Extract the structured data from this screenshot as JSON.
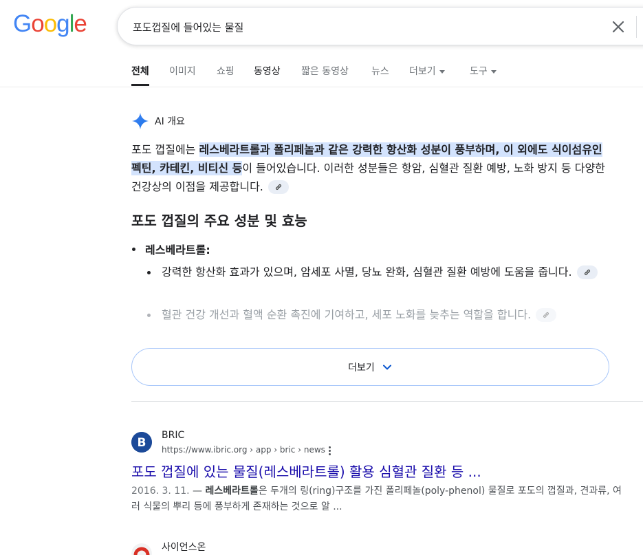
{
  "search": {
    "query": "포도껍질에 들어있는 물질"
  },
  "tabs": [
    {
      "label": "전체",
      "active": true
    },
    {
      "label": "이미지"
    },
    {
      "label": "쇼핑"
    },
    {
      "label": "동영상"
    },
    {
      "label": "짧은 동영상"
    },
    {
      "label": "뉴스"
    },
    {
      "label": "더보기"
    },
    {
      "label": "도구"
    }
  ],
  "ai_overview": {
    "label": "AI 개요",
    "intro_before": "포도 껍질에는 ",
    "intro_highlight": "레스베라트롤과 폴리페놀과 같은 강력한 항산화 성분이 풍부하며, 이 외에도 식이섬유인 펙틴, 카테킨, 비티신 등",
    "intro_after": "이 들어있습니다. 이러한 성분들은 항암, 심혈관 질환 예방, 노화 방지 등 다양한 건강상의 이점을 제공합니다.",
    "section_title": "포도 껍질의 주요 성분 및 효능",
    "item_title": "레스베라트롤:",
    "sub_items": [
      "강력한 항산화 효과가 있으며, 암세포 사멸, 당뇨 완화, 심혈관 질환 예방에 도움을 줍니다.",
      "혈관 건강 개선과 혈액 순환 촉진에 기여하고, 세포 노화를 늦추는 역할을 합니다."
    ],
    "more_label": "더보기"
  },
  "results": [
    {
      "site": "BRIC",
      "url": "https://www.ibric.org › app › bric › news",
      "title": "포도 껍질에 있는 물질(레스베라트롤) 활용 심혈관 질환 등 ...",
      "date": "2016. 3. 11.",
      "snippet_bold": "레스베라트롤",
      "snippet_rest": "은 두개의 링(ring)구조를 가진 폴리페놀(poly-phenol) 물질로 포도의 껍질과, 견과류, 여러 식물의 뿌리 등에 풍부하게 존재하는 것으로 알 ..."
    },
    {
      "site": "사이언스온"
    }
  ],
  "colors": {
    "link": "#1a0dab",
    "highlight": "#d3e3fd",
    "gemini": "#4285f4"
  }
}
